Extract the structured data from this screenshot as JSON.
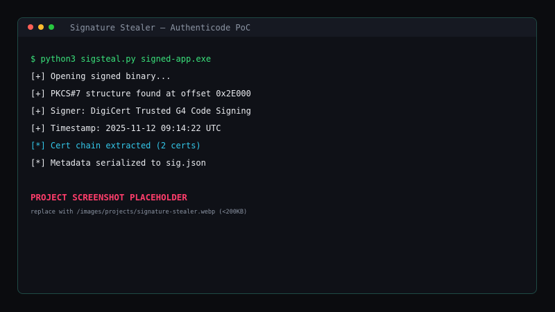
{
  "window": {
    "title": "Signature Stealer — Authenticode PoC",
    "controls": [
      {
        "name": "close",
        "color": "#ff5f57"
      },
      {
        "name": "minimize",
        "color": "#febc2e"
      },
      {
        "name": "maximize",
        "color": "#28c840"
      }
    ]
  },
  "terminal": {
    "lines": [
      {
        "text": "$ python3 sigsteal.py signed-app.exe",
        "style": "command"
      },
      {
        "text": "[+] Opening signed binary...",
        "style": "normal"
      },
      {
        "text": "[+] PKCS#7 structure found at offset 0x2E000",
        "style": "normal"
      },
      {
        "text": "[+] Signer: DigiCert Trusted G4 Code Signing",
        "style": "normal"
      },
      {
        "text": "[+] Timestamp: 2025-11-12 09:14:22 UTC",
        "style": "normal"
      },
      {
        "text": "[*] Cert chain extracted (2 certs)",
        "style": "highlight"
      },
      {
        "text": "[*] Metadata serialized to sig.json",
        "style": "normal"
      }
    ]
  },
  "placeholder": {
    "title": "PROJECT SCREENSHOT PLACEHOLDER",
    "subtitle": "replace with /images/projects/signature-stealer.webp (<200KB)"
  },
  "colors": {
    "command": "#39e07a",
    "highlight": "#33c6e8",
    "placeholder_title": "#ff3d6b",
    "border": "#1f4a45"
  }
}
